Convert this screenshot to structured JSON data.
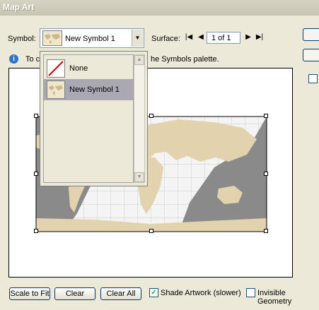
{
  "window": {
    "title": "Map Art"
  },
  "symbol": {
    "label": "Symbol:",
    "selected": "New Symbol 1",
    "options": [
      "None",
      "New Symbol 1"
    ]
  },
  "surface": {
    "label": "Surface:",
    "page": "1 of 1"
  },
  "info": {
    "text_left": "To c",
    "text_right": "he Symbols palette."
  },
  "buttons": {
    "scale_to_fit": "Scale to Fit",
    "clear": "Clear",
    "clear_all": "Clear All"
  },
  "options": {
    "shade_artwork": "Shade Artwork (slower)",
    "shade_artwork_checked": true,
    "invisible_geometry": "Invisible Geometry",
    "invisible_geometry_checked": false
  },
  "colors": {
    "land": "#e2d3ae",
    "ocean": "#8a8a8a",
    "grid": "#f2f2f2"
  }
}
